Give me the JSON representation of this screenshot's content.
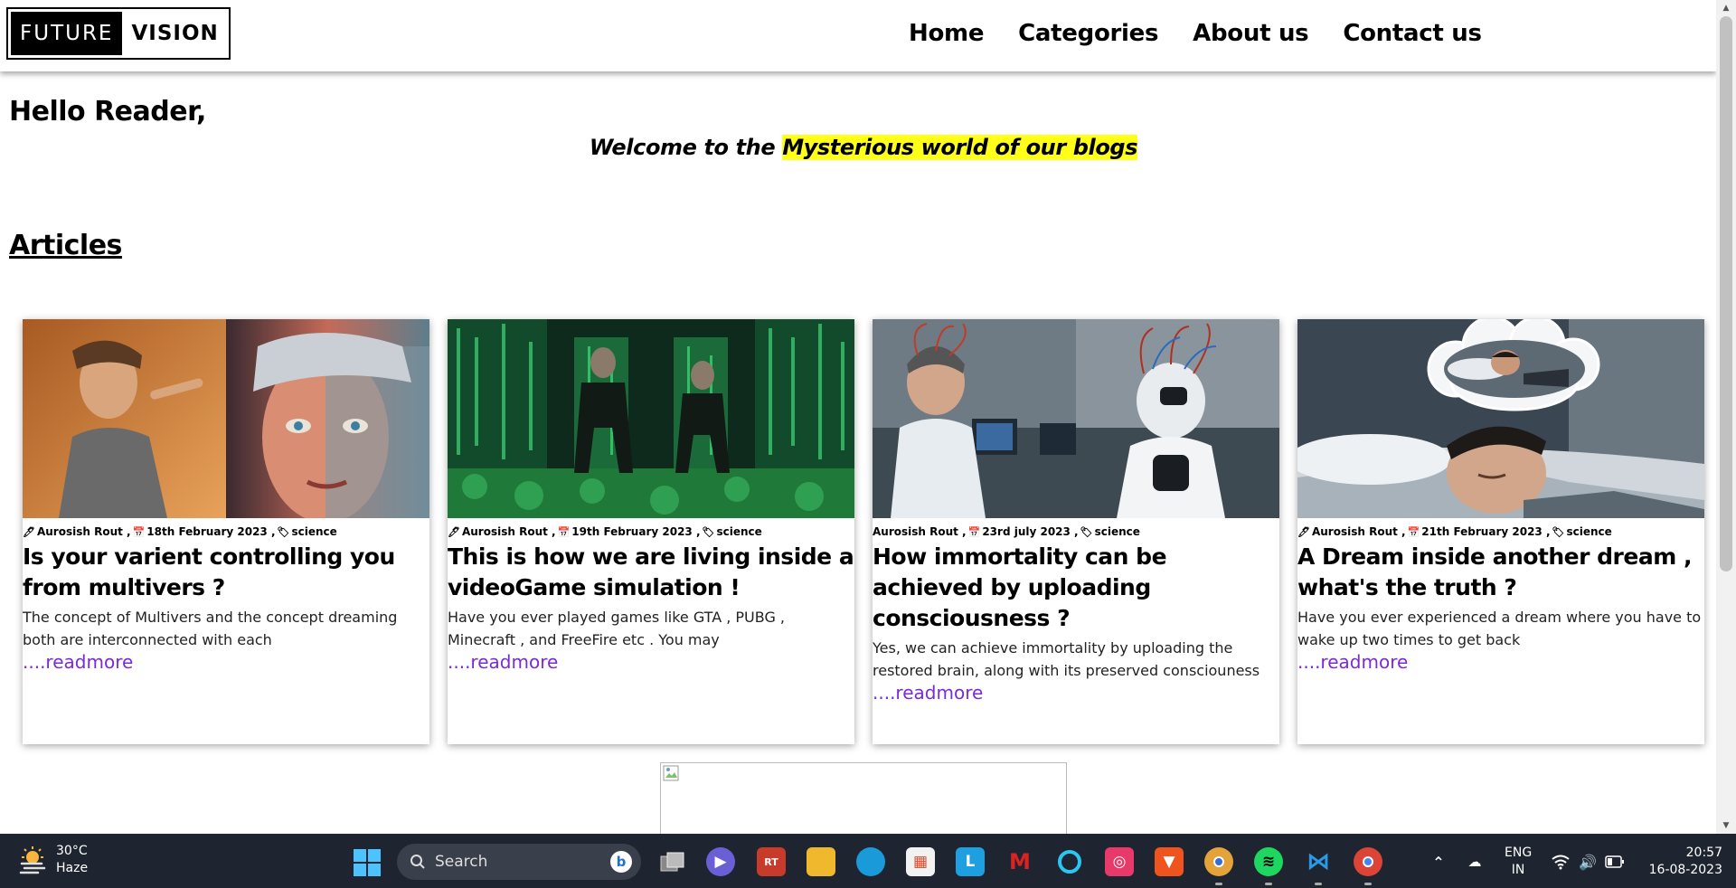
{
  "site": {
    "logo_left": "FUTURE",
    "logo_right": "VISION",
    "nav": [
      "Home",
      "Categories",
      "About us",
      "Contact us"
    ]
  },
  "hero": {
    "greeting": "Hello Reader,",
    "welcome_prefix": "Welcome to the ",
    "welcome_highlight": "Mysterious world of our blogs"
  },
  "articles": {
    "title": "Articles",
    "readmore": "....readmore",
    "items": [
      {
        "author": "Aurosish Rout ,",
        "date": "18th February 2023 ,",
        "category": "science",
        "title": "Is your varient controlling you from multivers ?",
        "excerpt": "The concept of Multivers and the concept dreaming both are interconnected with each",
        "image": "split-portrait-scifi"
      },
      {
        "author": "Aurosish Rout ,",
        "date": "19th February 2023 ,",
        "category": "science",
        "title": "This is how we are living inside a videoGame simulation !",
        "excerpt": "Have you ever played games like GTA , PUBG , Minecraft , and FreeFire etc . You may",
        "image": "matrix-green-code"
      },
      {
        "author": "Aurosish Rout ,",
        "date": "23rd july 2023 ,",
        "category": "science",
        "title": "How immortality can be achieved by uploading consciousness ?",
        "excerpt": "Yes, we can achieve immortality by uploading the restored brain, along with its preserved consciouness",
        "image": "robot-lab"
      },
      {
        "author": "Aurosish Rout ,",
        "date": "21th February 2023 ,",
        "category": "science",
        "title": "A Dream inside another dream , what's the truth ?",
        "excerpt": "Have you ever experienced a dream where you have to wake up two times to get back",
        "image": "dream-bubble-sleeping"
      }
    ]
  },
  "taskbar": {
    "weather_temp": "30°C",
    "weather_desc": "Haze",
    "search_placeholder": "Search",
    "lang_top": "ENG",
    "lang_bottom": "IN",
    "time": "20:57",
    "date": "16-08-2023",
    "icons": [
      "task-view-icon",
      "teams-icon",
      "game-icon",
      "file-explorer-icon",
      "edge-icon",
      "store-icon",
      "launcher-icon",
      "mcafee-icon",
      "alexa-icon",
      "creative-cloud-icon",
      "brave-icon",
      "chrome-canary-icon",
      "spotify-icon",
      "vscode-icon",
      "chrome-icon"
    ]
  }
}
